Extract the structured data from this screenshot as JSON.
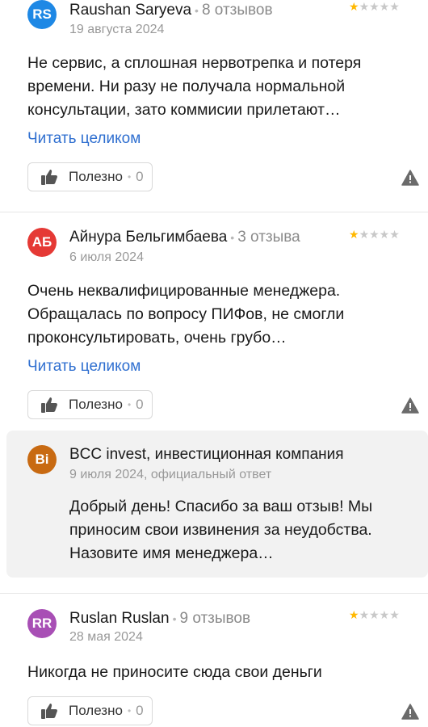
{
  "reviews": [
    {
      "initials": "RS",
      "avatar_color": "#1e88e5",
      "name": "Raushan Saryeva",
      "review_count": "8 отзывов",
      "date": "19 августа 2024",
      "rating": 1,
      "text": "Не сервис, а сплошная нервотрепка и потеря\nвремени. Ни разу не получала нормальной\nконсультации, зато коммисии прилетают…",
      "read_more": "Читать целиком",
      "helpful_label": "Полезно",
      "helpful_count": "0"
    },
    {
      "initials": "АБ",
      "avatar_color": "#e53935",
      "name": "Айнура Бельгимбаева",
      "review_count": "3 отзыва",
      "date": "6 июля 2024",
      "rating": 1,
      "text": "Очень неквалифицированные менеджера.\nОбращалась по вопросу ПИФов, не смогли\nпроконсультировать, очень грубо…",
      "read_more": "Читать целиком",
      "helpful_label": "Полезно",
      "helpful_count": "0",
      "official_answer": {
        "initials": "Bi",
        "avatar_color": "#c86a12",
        "company": "BCC invest, инвестиционная компания",
        "date": "9 июля 2024, официальный ответ",
        "text": "Добрый день! Спасибо за ваш отзыв! Мы\nприносим свои извинения за неудобства.\nНазовите имя менеджера…"
      }
    },
    {
      "initials": "RR",
      "avatar_color": "#a84fb5",
      "name": "Ruslan Ruslan",
      "review_count": "9 отзывов",
      "date": "28 мая 2024",
      "rating": 1,
      "text": "Никогда не приносите сюда свои деньги",
      "helpful_label": "Полезно",
      "helpful_count": "0"
    }
  ],
  "icons": {
    "thumb": "thumbs-up-icon",
    "warn": "warning-icon",
    "star": "star-icon"
  }
}
